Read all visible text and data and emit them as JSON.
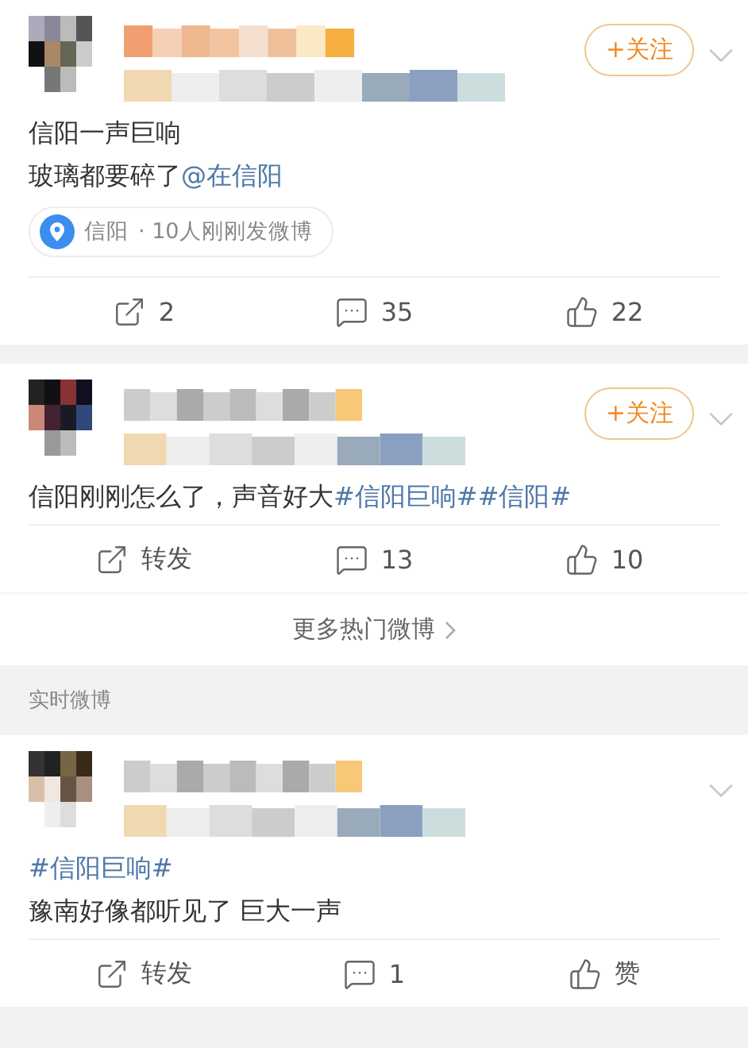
{
  "posts": [
    {
      "follow": "+关注",
      "lines": [
        [
          {
            "kind": "plain",
            "text": "信阳一声巨响"
          }
        ],
        [
          {
            "kind": "plain",
            "text": "玻璃都要碎了"
          },
          {
            "kind": "link",
            "text": "@在信阳"
          }
        ]
      ],
      "location": {
        "name": "信阳",
        "info": "· 10人刚刚发微博"
      },
      "actions": [
        {
          "kind": "repost",
          "label": "2"
        },
        {
          "kind": "comment",
          "label": "35"
        },
        {
          "kind": "like",
          "label": "22"
        }
      ]
    },
    {
      "follow": "+关注",
      "lines": [
        [
          {
            "kind": "plain",
            "text": "信阳刚刚怎么了，声音好大"
          },
          {
            "kind": "link",
            "text": "#信阳巨响#"
          },
          {
            "kind": "link",
            "text": "#信阳#"
          }
        ]
      ],
      "actions": [
        {
          "kind": "repost",
          "label": "转发"
        },
        {
          "kind": "comment",
          "label": "13"
        },
        {
          "kind": "like",
          "label": "10"
        }
      ],
      "more": "更多热门微博"
    },
    {
      "section": "实时微博",
      "lines": [
        [
          {
            "kind": "link",
            "text": "#信阳巨响#"
          }
        ],
        [
          {
            "kind": "plain",
            "text": "豫南好像都听见了 巨大一声"
          }
        ]
      ],
      "actions": [
        {
          "kind": "repost",
          "label": "转发"
        },
        {
          "kind": "comment",
          "label": "1"
        },
        {
          "kind": "like",
          "label": "赞"
        }
      ]
    }
  ]
}
